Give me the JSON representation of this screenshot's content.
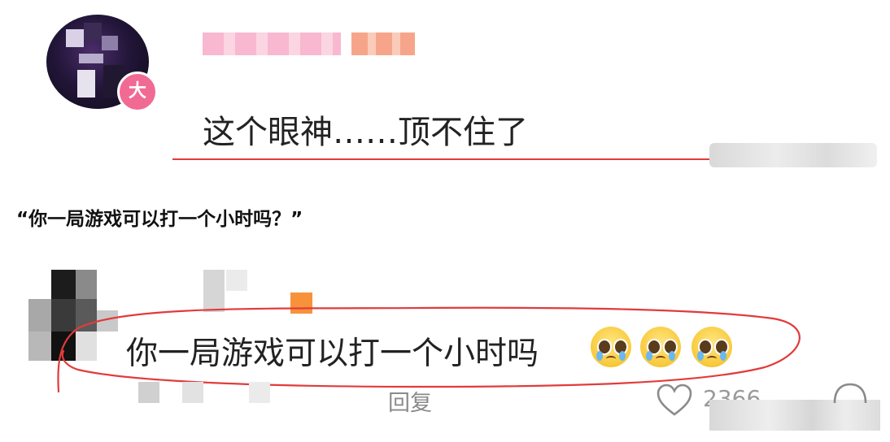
{
  "comment": {
    "text": "这个眼神……顶不住了",
    "badge": "大"
  },
  "caption": "“你一局游戏可以打一个小时吗？”",
  "reply": {
    "text": "你一局游戏可以打一个小时吗",
    "emoji_count": 3,
    "emoji_name": "pleading-crying-face-icon",
    "action_label": "回复",
    "like_count": "2366"
  },
  "colors": {
    "annotation_red": "#e23b3b",
    "badge_pink": "#f06a94"
  }
}
